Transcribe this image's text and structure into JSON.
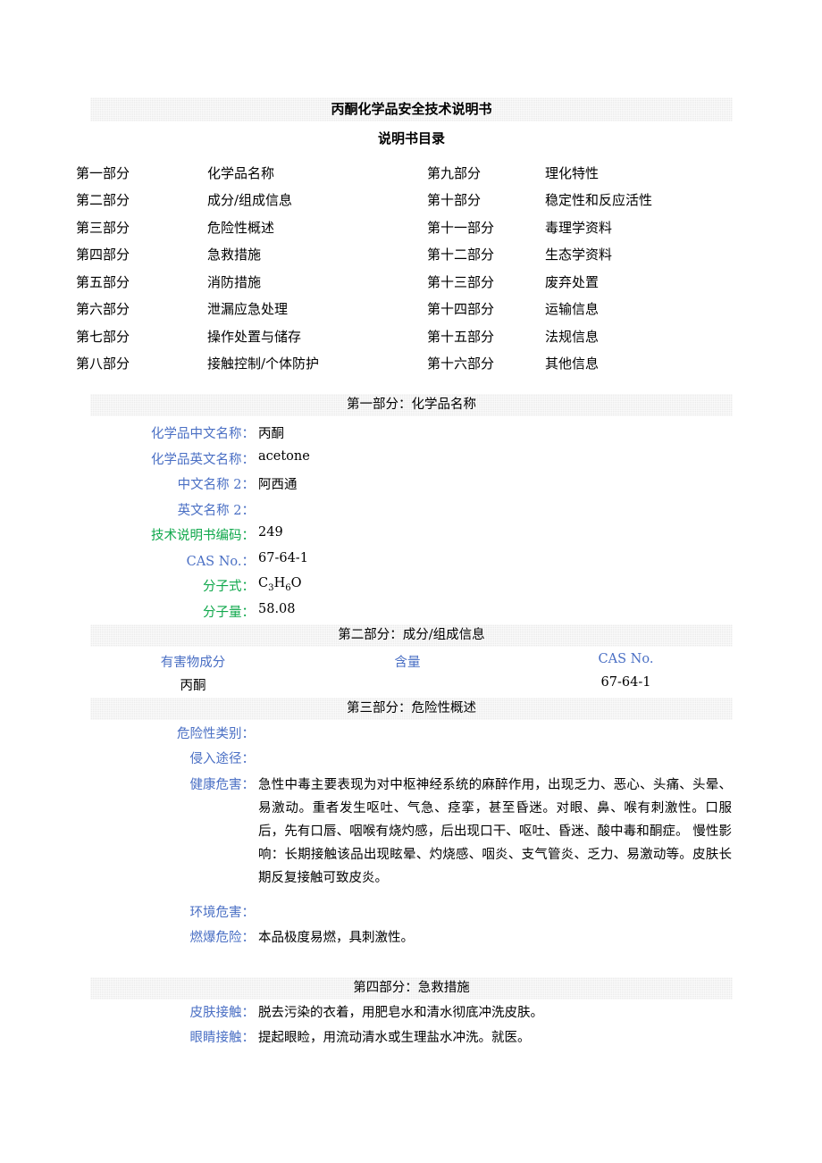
{
  "document": {
    "title": "丙酮化学品安全技术说明书",
    "subtitle": "说明书目录"
  },
  "toc": {
    "rows": [
      {
        "left_no": "第一部分",
        "left_name": "化学品名称",
        "right_no": "第九部分",
        "right_name": "理化特性"
      },
      {
        "left_no": "第二部分",
        "left_name": "成分/组成信息",
        "right_no": "第十部分",
        "right_name": "稳定性和反应活性"
      },
      {
        "left_no": "第三部分",
        "left_name": "危险性概述",
        "right_no": "第十一部分",
        "right_name": "毒理学资料"
      },
      {
        "left_no": "第四部分",
        "left_name": "急救措施",
        "right_no": "第十二部分",
        "right_name": "生态学资料"
      },
      {
        "left_no": "第五部分",
        "left_name": "消防措施",
        "right_no": "第十三部分",
        "right_name": "废弃处置"
      },
      {
        "left_no": "第六部分",
        "left_name": "泄漏应急处理",
        "right_no": "第十四部分",
        "right_name": "运输信息"
      },
      {
        "left_no": "第七部分",
        "left_name": "操作处置与储存",
        "right_no": "第十五部分",
        "right_name": "法规信息"
      },
      {
        "left_no": "第八部分",
        "left_name": "接触控制/个体防护",
        "right_no": "第十六部分",
        "right_name": "其他信息"
      }
    ]
  },
  "section1": {
    "header": "第一部分：化学品名称",
    "fields": [
      {
        "label": "化学品中文名称：",
        "value": "丙酮",
        "color": "#4a6fc4"
      },
      {
        "label": "化学品英文名称：",
        "value": "acetone",
        "color": "#4a6fc4"
      },
      {
        "label": "中文名称 2：",
        "value": "阿西通",
        "color": "#4a6fc4"
      },
      {
        "label": "英文名称 2：",
        "value": "",
        "color": "#4a6fc4"
      },
      {
        "label": "技术说明书编码：",
        "value": "249",
        "color": "#10a84c"
      },
      {
        "label": "CAS No.：",
        "value": "67-64-1",
        "color": "#4a6fc4"
      },
      {
        "label": "分子式：",
        "value": "C3H6O",
        "color": "#10a84c"
      },
      {
        "label": "分子量：",
        "value": "58.08",
        "color": "#10a84c"
      }
    ],
    "formula": {
      "c": "C",
      "c_sub": "3",
      "h": "H",
      "h_sub": "6",
      "o": "O"
    }
  },
  "section2": {
    "header": "第二部分：成分/组成信息",
    "columns": [
      "有害物成分",
      "含量",
      "CAS No."
    ],
    "rows": [
      {
        "component": "丙酮",
        "content": "",
        "cas": "67-64-1"
      }
    ]
  },
  "section3": {
    "header": "第三部分：危险性概述",
    "fields": [
      {
        "label": "危险性类别：",
        "value": ""
      },
      {
        "label": "侵入途径：",
        "value": ""
      },
      {
        "label": "健康危害：",
        "value": "急性中毒主要表现为对中枢神经系统的麻醉作用，出现乏力、恶心、头痛、头晕、易激动。重者发生呕吐、气急、痉挛，甚至昏迷。对眼、鼻、喉有刺激性。口服后，先有口唇、咽喉有烧灼感，后出现口干、呕吐、昏迷、酸中毒和酮症。 慢性影响：长期接触该品出现眩晕、灼烧感、咽炎、支气管炎、乏力、易激动等。皮肤长期反复接触可致皮炎。"
      },
      {
        "label": "环境危害：",
        "value": ""
      },
      {
        "label": "燃爆危险：",
        "value": "本品极度易燃，具刺激性。"
      }
    ]
  },
  "section4": {
    "header": "第四部分：急救措施",
    "fields": [
      {
        "label": "皮肤接触：",
        "value": "脱去污染的衣着，用肥皂水和清水彻底冲洗皮肤。"
      },
      {
        "label": "眼睛接触：",
        "value": "提起眼睑，用流动清水或生理盐水冲洗。就医。"
      }
    ]
  },
  "colors": {
    "label_blue": "#4a6fc4",
    "label_green": "#10a84c",
    "band_gray": "#ebebeb",
    "text_black": "#000000"
  }
}
